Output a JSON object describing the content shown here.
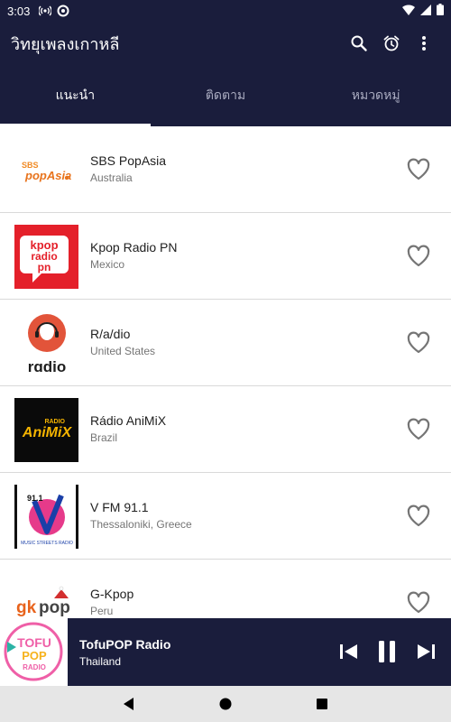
{
  "status_bar": {
    "time": "3:03",
    "icons": [
      "hotspot-icon",
      "sync-icon",
      "wifi-icon",
      "signal-icon",
      "battery-icon"
    ]
  },
  "app_bar": {
    "title": "วิทยุเพลงเกาหลี",
    "actions": [
      "search-icon",
      "alarm-icon",
      "more-vert-icon"
    ]
  },
  "tabs": [
    {
      "label": "แนะนำ",
      "active": true
    },
    {
      "label": "ติดตาม",
      "active": false
    },
    {
      "label": "หมวดหมู่",
      "active": false
    }
  ],
  "stations": [
    {
      "name": "SBS PopAsia",
      "country": "Australia",
      "logo_text": "SBS PopAsia"
    },
    {
      "name": "Kpop Radio PN",
      "country": "Mexico",
      "logo_text": "kpop radio pn"
    },
    {
      "name": "R/a/dio",
      "country": "United States",
      "logo_text": "radio"
    },
    {
      "name": "Rádio AniMiX",
      "country": "Brazil",
      "logo_text": "AniMiX"
    },
    {
      "name": "V FM 91.1",
      "country": "Thessaloniki, Greece",
      "logo_text": "91.1"
    },
    {
      "name": "G-Kpop",
      "country": "Peru",
      "logo_text": "gkpop"
    }
  ],
  "now_playing": {
    "name": "TofuPOP Radio",
    "country": "Thailand",
    "logo_text": "TOFU POP RADIO"
  },
  "colors": {
    "primary": "#1a1d3c",
    "tab_inactive": "#a9abc0",
    "heart": "#757575"
  }
}
